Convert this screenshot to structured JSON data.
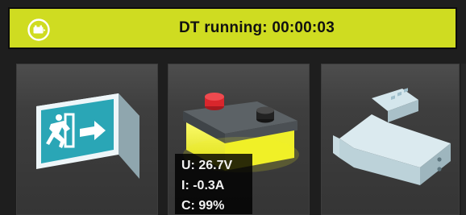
{
  "header": {
    "title": "DT running: 00:00:03",
    "icon": "battery-cycle-icon",
    "background_color": "#cfdc21"
  },
  "tiles": [
    {
      "name": "exit-sign",
      "icon": "emergency-exit-sign-icon"
    },
    {
      "name": "battery",
      "icon": "battery-icon",
      "readout": {
        "voltage": "U: 26.7V",
        "current": "I: -0.3A",
        "capacity": "C: 99%"
      }
    },
    {
      "name": "din-rail-module",
      "icon": "din-rail-module-icon"
    }
  ],
  "colors": {
    "accent": "#cfdc21",
    "panel": "#3e3e3e",
    "battery_glow": "#f2f21a",
    "battery_plus": "#d9262c"
  }
}
